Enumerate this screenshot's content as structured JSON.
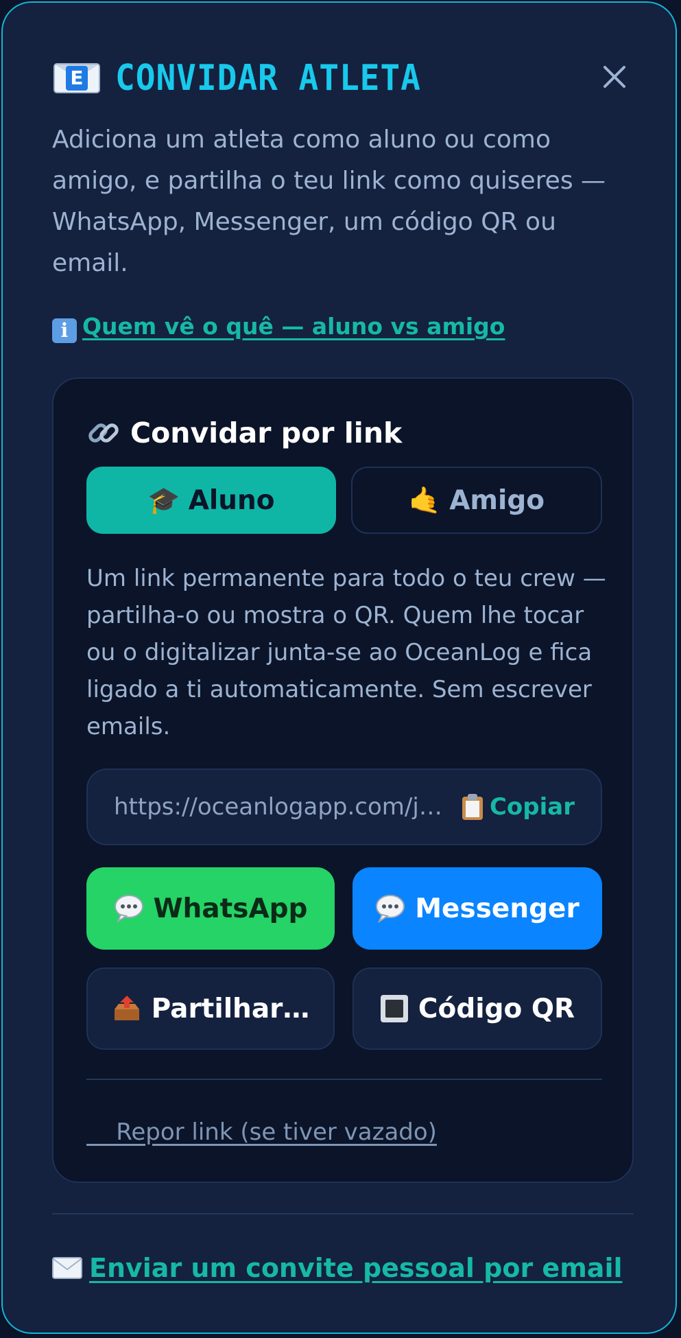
{
  "modal": {
    "title": "CONVIDAR ATLETA",
    "title_icon": "envelope-icon",
    "close_icon": "close-icon",
    "intro": "Adiciona um atleta como aluno ou como amigo, e partilha o teu link como quiseres — WhatsApp, Messenger, um código QR ou email.",
    "who_sees_link": "Quem vê o quê — aluno vs amigo",
    "who_sees_icon": "info-icon"
  },
  "invite_card": {
    "title": "Convidar por link",
    "title_icon": "link-icon",
    "segments": [
      {
        "label": "Aluno",
        "icon": "graduation-cap-icon",
        "selected": true
      },
      {
        "label": "Amigo",
        "icon": "call-me-hand-icon",
        "selected": false
      }
    ],
    "description": "Um link permanente para todo o teu crew — partilha-o ou mostra o QR. Quem lhe tocar ou o digitalizar junta-se ao OceanLog e fica ligado a ti automaticamente. Sem escrever emails.",
    "link_url": "https://oceanlogapp.com/j…",
    "copy_label": "Copiar",
    "copy_icon": "clipboard-icon",
    "buttons": {
      "whatsapp": "WhatsApp",
      "messenger": "Messenger",
      "share": "Partilhar…",
      "qr": "Código QR"
    },
    "reset_label": "    Repor link (se tiver vazado)"
  },
  "footer": {
    "email_invite": "Enviar um convite pessoal por email",
    "email_icon": "envelope-icon"
  },
  "colors": {
    "accent": "#18c9ec",
    "teal": "#16b8a6",
    "whatsapp": "#25d366",
    "messenger": "#0a84ff",
    "background": "#14213f"
  }
}
